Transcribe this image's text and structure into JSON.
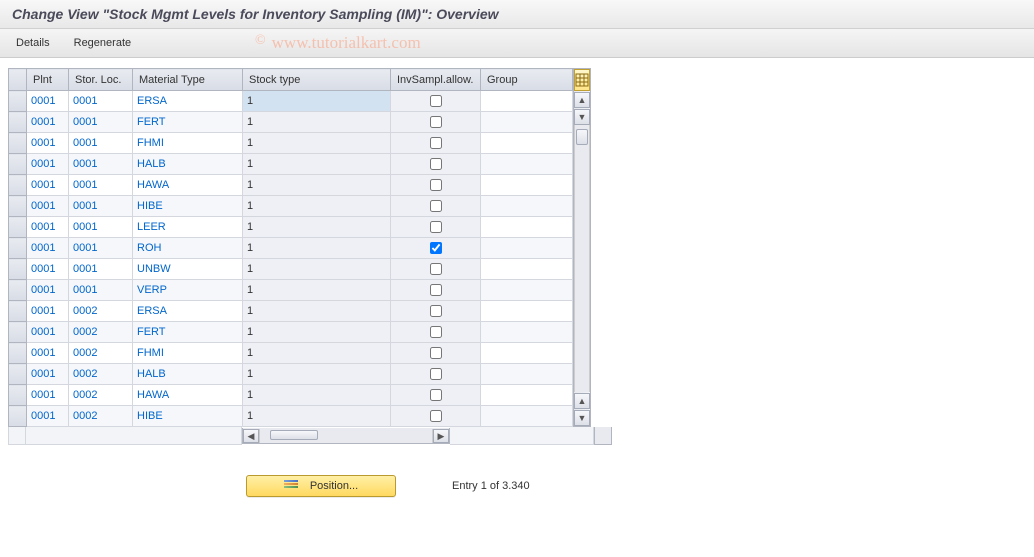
{
  "title": "Change View \"Stock Mgmt Levels for Inventory Sampling (IM)\": Overview",
  "toolbar": {
    "details_label": "Details",
    "regenerate_label": "Regenerate"
  },
  "watermark": "www.tutorialkart.com",
  "columns": {
    "plnt": "Plnt",
    "stor": "Stor. Loc.",
    "material_type": "Material Type",
    "stock_type": "Stock type",
    "inv_sampl_allow": "InvSampl.allow.",
    "group": "Group"
  },
  "rows": [
    {
      "plnt": "0001",
      "stor": "0001",
      "mat": "ERSA",
      "stock": "1",
      "inv": false,
      "group": "",
      "selected": true
    },
    {
      "plnt": "0001",
      "stor": "0001",
      "mat": "FERT",
      "stock": "1",
      "inv": false,
      "group": ""
    },
    {
      "plnt": "0001",
      "stor": "0001",
      "mat": "FHMI",
      "stock": "1",
      "inv": false,
      "group": ""
    },
    {
      "plnt": "0001",
      "stor": "0001",
      "mat": "HALB",
      "stock": "1",
      "inv": false,
      "group": ""
    },
    {
      "plnt": "0001",
      "stor": "0001",
      "mat": "HAWA",
      "stock": "1",
      "inv": false,
      "group": ""
    },
    {
      "plnt": "0001",
      "stor": "0001",
      "mat": "HIBE",
      "stock": "1",
      "inv": false,
      "group": ""
    },
    {
      "plnt": "0001",
      "stor": "0001",
      "mat": "LEER",
      "stock": "1",
      "inv": false,
      "group": ""
    },
    {
      "plnt": "0001",
      "stor": "0001",
      "mat": "ROH",
      "stock": "1",
      "inv": true,
      "group": ""
    },
    {
      "plnt": "0001",
      "stor": "0001",
      "mat": "UNBW",
      "stock": "1",
      "inv": false,
      "group": ""
    },
    {
      "plnt": "0001",
      "stor": "0001",
      "mat": "VERP",
      "stock": "1",
      "inv": false,
      "group": ""
    },
    {
      "plnt": "0001",
      "stor": "0002",
      "mat": "ERSA",
      "stock": "1",
      "inv": false,
      "group": ""
    },
    {
      "plnt": "0001",
      "stor": "0002",
      "mat": "FERT",
      "stock": "1",
      "inv": false,
      "group": ""
    },
    {
      "plnt": "0001",
      "stor": "0002",
      "mat": "FHMI",
      "stock": "1",
      "inv": false,
      "group": ""
    },
    {
      "plnt": "0001",
      "stor": "0002",
      "mat": "HALB",
      "stock": "1",
      "inv": false,
      "group": ""
    },
    {
      "plnt": "0001",
      "stor": "0002",
      "mat": "HAWA",
      "stock": "1",
      "inv": false,
      "group": ""
    },
    {
      "plnt": "0001",
      "stor": "0002",
      "mat": "HIBE",
      "stock": "1",
      "inv": false,
      "group": ""
    }
  ],
  "footer": {
    "position_label": "Position...",
    "entry_status": "Entry 1 of 3.340"
  }
}
